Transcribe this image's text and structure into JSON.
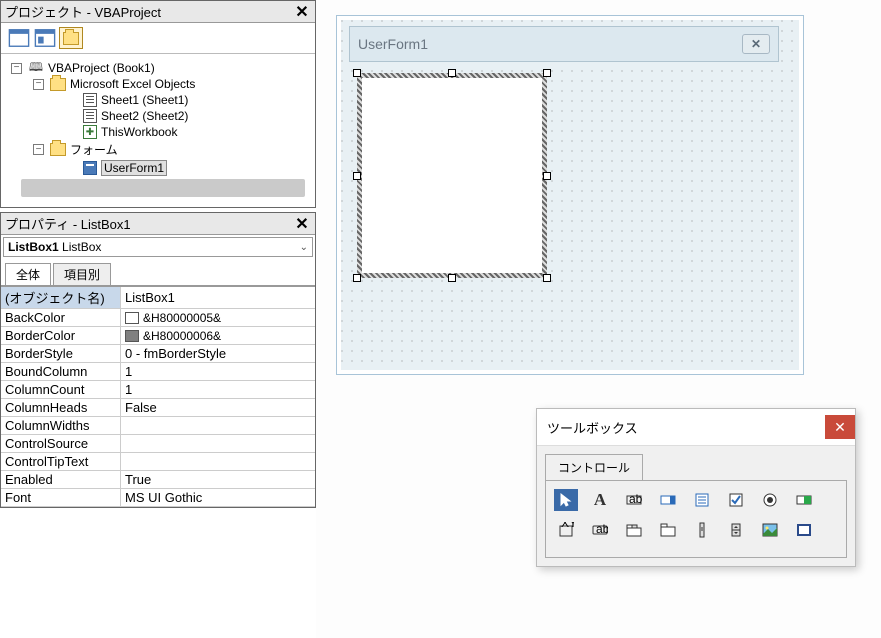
{
  "project_pane": {
    "title": "プロジェクト - VBAProject",
    "tree": {
      "root": "VBAProject (Book1)",
      "excel_objects": "Microsoft Excel Objects",
      "sheet1": "Sheet1 (Sheet1)",
      "sheet2": "Sheet2 (Sheet2)",
      "workbook": "ThisWorkbook",
      "forms": "フォーム",
      "userform": "UserForm1"
    }
  },
  "props_pane": {
    "title": "プロパティ - ListBox1",
    "object_name": "ListBox1",
    "object_type": "ListBox",
    "tabs": {
      "all": "全体",
      "by_category": "項目別"
    },
    "rows": {
      "object_name_label": "(オブジェクト名)",
      "object_name_value": "ListBox1",
      "back_color_label": "BackColor",
      "back_color_value": "&H80000005&",
      "border_color_label": "BorderColor",
      "border_color_value": "&H80000006&",
      "border_style_label": "BorderStyle",
      "border_style_value": "0 - fmBorderStyle",
      "bound_column_label": "BoundColumn",
      "bound_column_value": "1",
      "column_count_label": "ColumnCount",
      "column_count_value": "1",
      "column_heads_label": "ColumnHeads",
      "column_heads_value": "False",
      "column_widths_label": "ColumnWidths",
      "column_widths_value": "",
      "control_source_label": "ControlSource",
      "control_source_value": "",
      "control_tip_label": "ControlTipText",
      "control_tip_value": "",
      "enabled_label": "Enabled",
      "enabled_value": "True",
      "font_label": "Font",
      "font_value": "MS UI Gothic"
    }
  },
  "designer": {
    "form_title": "UserForm1"
  },
  "toolbox": {
    "title": "ツールボックス",
    "tab": "コントロール"
  },
  "colors": {
    "backcolor_swatch": "#ffffff",
    "bordercolor_swatch": "#808080"
  }
}
